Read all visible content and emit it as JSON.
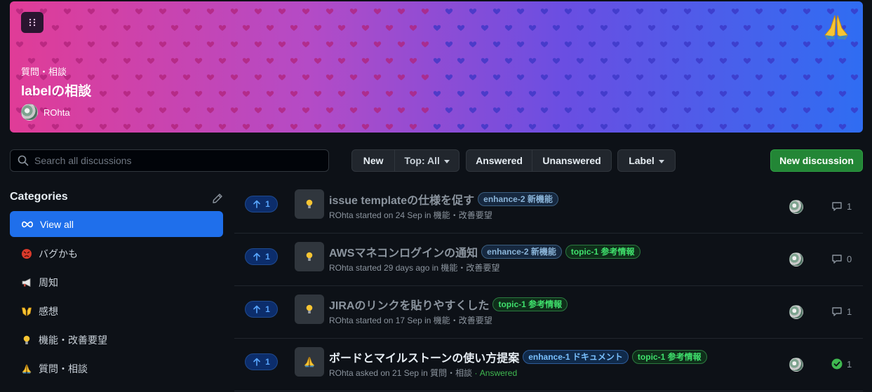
{
  "banner": {
    "category": "質問・相談",
    "title": "labelの相談",
    "author": "ROhta",
    "emoji_icon": "folded-hands-icon",
    "menu_icon": "grid-dots-icon"
  },
  "toolbar": {
    "search_placeholder": "Search all discussions",
    "new_label": "New",
    "top_label": "Top: All",
    "answered_label": "Answered",
    "unanswered_label": "Unanswered",
    "label_label": "Label",
    "new_discussion_label": "New discussion"
  },
  "sidebar": {
    "title": "Categories",
    "items": [
      {
        "label": "View all",
        "icon": "infinity-icon"
      },
      {
        "label": "バグかも",
        "icon": "angry-face-icon"
      },
      {
        "label": "周知",
        "icon": "megaphone-icon"
      },
      {
        "label": "感想",
        "icon": "raising-hands-icon"
      },
      {
        "label": "機能・改善要望",
        "icon": "lightbulb-icon"
      },
      {
        "label": "質問・相談",
        "icon": "folded-hands-icon"
      }
    ]
  },
  "discussions": [
    {
      "votes": "1",
      "title": "issue templateの仕様を促す",
      "labels": [
        {
          "text": "enhance-2 新機能",
          "style": "blue"
        }
      ],
      "meta": "ROhta started on 24 Sep in 機能・改善要望",
      "answered": "",
      "count": "1",
      "icon": "lightbulb-icon"
    },
    {
      "votes": "1",
      "title": "AWSマネコンログインの通知",
      "labels": [
        {
          "text": "enhance-2 新機能",
          "style": "blue"
        },
        {
          "text": "topic-1 参考情報",
          "style": "green"
        }
      ],
      "meta": "ROhta started 29 days ago in 機能・改善要望",
      "answered": "",
      "count": "0",
      "icon": "lightbulb-icon"
    },
    {
      "votes": "1",
      "title": "JIRAのリンクを貼りやすくした",
      "labels": [
        {
          "text": "topic-1 参考情報",
          "style": "green"
        }
      ],
      "meta": "ROhta started on 17 Sep in 機能・改善要望",
      "answered": "",
      "count": "1",
      "icon": "lightbulb-icon"
    },
    {
      "votes": "1",
      "title": "ボードとマイルストーンの使い方提案",
      "labels": [
        {
          "text": "enhance-1 ドキュメント",
          "style": "blue2"
        },
        {
          "text": "topic-1 参考情報",
          "style": "green"
        }
      ],
      "meta": "ROhta asked on 21 Sep in 質問・相談",
      "answered": "· Answered",
      "count": "1",
      "icon": "folded-hands-icon"
    }
  ]
}
